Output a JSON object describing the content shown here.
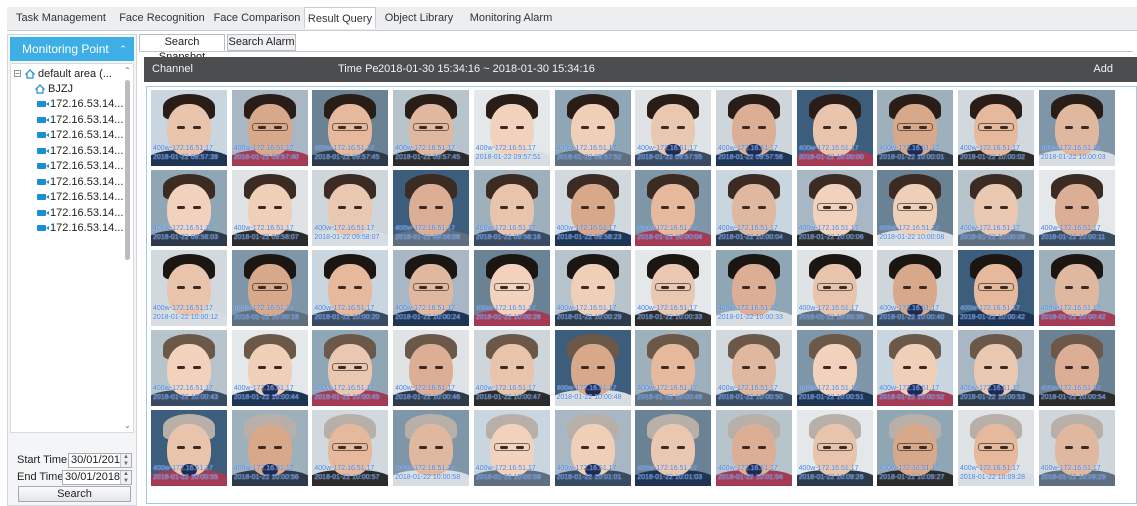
{
  "top_tabs": [
    "Task Management",
    "Face Recognition",
    "Face Comparison",
    "Result Query",
    "Object Library",
    "Monitoring Alarm"
  ],
  "left_panel": {
    "title": "Monitoring Point",
    "tree": {
      "root": "default area (...",
      "area": "BJZJ",
      "cameras": [
        "172.16.53.14...",
        "172.16.53.14...",
        "172.16.53.14...",
        "172.16.53.14...",
        "172.16.53.14...",
        "172.16.53.14...",
        "172.16.53.14...",
        "172.16.53.14...",
        "172.16.53.14..."
      ]
    },
    "start_time_label": "Start Time",
    "start_time_value": "30/01/201",
    "end_time_label": "End Time",
    "end_time_value": "30/01/2018",
    "search_label": "Search"
  },
  "sub_tabs": [
    "Search Snapshot",
    "Search Alarm"
  ],
  "result_bar": {
    "channel_label": "Channel",
    "time_label": "Time Pe",
    "time_range": "2018-01-30 15:34:16 ~ 2018-01-30 15:34:16",
    "add_label": "Add"
  },
  "snapshots": [
    {
      "cap1": "400w-172.16.51.17",
      "cap2": "2018-01-22 09:57:39"
    },
    {
      "cap1": "400w-172.16.51.17",
      "cap2": "2018-01-22 09:57:40"
    },
    {
      "cap1": "400w-172.16.51.17",
      "cap2": "2018-01-22 09:57:45"
    },
    {
      "cap1": "400w-172.16.51.17",
      "cap2": "2018-01-22 09:57:45"
    },
    {
      "cap1": "400w-172.16.51.17",
      "cap2": "2018-01-22 09:57:51"
    },
    {
      "cap1": "400w-172.16.51.17",
      "cap2": "2018-01-22 09:57:52"
    },
    {
      "cap1": "400w-172.16.51.17",
      "cap2": "2018-01-22 09:57:55"
    },
    {
      "cap1": "400w-172.16.51.17",
      "cap2": "2018-01-22 09:57:56"
    },
    {
      "cap1": "400w-172.16.51.17",
      "cap2": "2018-01-22 10:00:00"
    },
    {
      "cap1": "400w-172.16.51.17",
      "cap2": "2018-01-22 10:00:01"
    },
    {
      "cap1": "400w-172.16.51.17",
      "cap2": "2018-01-22 10:00:02"
    },
    {
      "cap1": "400w-172.16.51.17",
      "cap2": "2018-01-22 10:00:03"
    },
    {
      "cap1": "400w-172.16.51.17",
      "cap2": "2018-01-22 09:58:03"
    },
    {
      "cap1": "400w-172.16.51.17",
      "cap2": "2018-01-22 09:58:07"
    },
    {
      "cap1": "400w-172.16.51.17",
      "cap2": "2018-01-22 09:58:07"
    },
    {
      "cap1": "400w-172.16.51.17",
      "cap2": "2018-01-22 09:58:08"
    },
    {
      "cap1": "400w-172.16.51.17",
      "cap2": "2018-01-22 09:58:16"
    },
    {
      "cap1": "400w-172.16.51.17",
      "cap2": "2018-01-22 09:58:23"
    },
    {
      "cap1": "400w-172.16.51.17",
      "cap2": "2018-01-22 10:00:04"
    },
    {
      "cap1": "400w-172.16.51.17",
      "cap2": "2018-01-22 10:00:04"
    },
    {
      "cap1": "400w-172.16.51.17",
      "cap2": "2018-01-22 10:00:06"
    },
    {
      "cap1": "400w-172.16.51.17",
      "cap2": "2018-01-22 10:00:08"
    },
    {
      "cap1": "400w-172.16.51.17",
      "cap2": "2018-01-22 10:00:09"
    },
    {
      "cap1": "400w-172.16.51.17",
      "cap2": "2018-01-22 10:00:11"
    },
    {
      "cap1": "400w-172.16.51.17",
      "cap2": "2018-01-22 10:00:12"
    },
    {
      "cap1": "400w-172.16.51.17",
      "cap2": "2018-01-22 10:00:18"
    },
    {
      "cap1": "400w-172.16.51.17",
      "cap2": "2018-01-22 10:00:20"
    },
    {
      "cap1": "400w-172.16.51.17",
      "cap2": "2018-01-22 10:00:24"
    },
    {
      "cap1": "400w-172.16.51.17",
      "cap2": "2018-01-22 10:00:26"
    },
    {
      "cap1": "400w-172.16.51.17",
      "cap2": "2018-01-22 10:00:29"
    },
    {
      "cap1": "400w-172.16.51.17",
      "cap2": "2018-01-22 10:00:33"
    },
    {
      "cap1": "400w-172.16.51.17",
      "cap2": "2018-01-22 10:00:33"
    },
    {
      "cap1": "400w-172.16.51.17",
      "cap2": "2018-01-22 10:00:36"
    },
    {
      "cap1": "400w-172.16.51.17",
      "cap2": "2018-01-22 10:00:40"
    },
    {
      "cap1": "400w-172.16.51.17",
      "cap2": "2018-01-22 10:00:42"
    },
    {
      "cap1": "400w-172.16.51.17",
      "cap2": "2018-01-22 10:00:42"
    },
    {
      "cap1": "400w-172.16.51.17",
      "cap2": "2018-01-22 10:00:43"
    },
    {
      "cap1": "400w-172.16.51.17",
      "cap2": "2018-01-22 10:00:44"
    },
    {
      "cap1": "400w-172.16.51.17",
      "cap2": "2018-01-22 10:00:45"
    },
    {
      "cap1": "400w-172.16.51.17",
      "cap2": "2018-01-22 10:00:46"
    },
    {
      "cap1": "400w-172.16.51.17",
      "cap2": "2018-01-22 10:00:47"
    },
    {
      "cap1": "400w-172.16.51.17",
      "cap2": "2018-01-22 10:00:48"
    },
    {
      "cap1": "400w-172.16.51.17",
      "cap2": "2018-01-22 10:00:49"
    },
    {
      "cap1": "400w-172.16.51.17",
      "cap2": "2018-01-22 10:00:50"
    },
    {
      "cap1": "400w-172.16.51.17",
      "cap2": "2018-01-22 10:00:51"
    },
    {
      "cap1": "400w-172.16.51.17",
      "cap2": "2018-01-22 10:00:52"
    },
    {
      "cap1": "400w-172.16.51.17",
      "cap2": "2018-01-22 10:00:53"
    },
    {
      "cap1": "400w-172.16.51.17",
      "cap2": "2018-01-22 10:00:54"
    },
    {
      "cap1": "400w-172.16.51.17",
      "cap2": "2018-01-22 10:00:55"
    },
    {
      "cap1": "400w-172.16.51.17",
      "cap2": "2018-01-22 10:00:56"
    },
    {
      "cap1": "400w-172.16.51.17",
      "cap2": "2018-01-22 10:00:57"
    },
    {
      "cap1": "400w-172.16.51.17",
      "cap2": "2018-01-22 10:00:58"
    },
    {
      "cap1": "400w-172.16.51.17",
      "cap2": "2018-01-22 10:00:59"
    },
    {
      "cap1": "400w-172.16.51.17",
      "cap2": "2018-01-22 10:01:01"
    },
    {
      "cap1": "400w-172.16.51.17",
      "cap2": "2018-01-22 10:01:03"
    },
    {
      "cap1": "400w-172.16.51.17",
      "cap2": "2018-01-22 10:01:04"
    },
    {
      "cap1": "400w-172.16.51.17",
      "cap2": "2018-01-22 10:09:26"
    },
    {
      "cap1": "400w-172.16.51.17",
      "cap2": "2018-01-22 10:09:27"
    },
    {
      "cap1": "400w-172.16.51.17",
      "cap2": "2018-01-22 10:09:28"
    },
    {
      "cap1": "400w-172.16.51.17",
      "cap2": "2018-01-22 10:09:29"
    }
  ],
  "colors": {
    "header_blue": "#3eaee6",
    "caption_blue": "#3f7fe0",
    "result_bar": "#4c4d4f"
  }
}
